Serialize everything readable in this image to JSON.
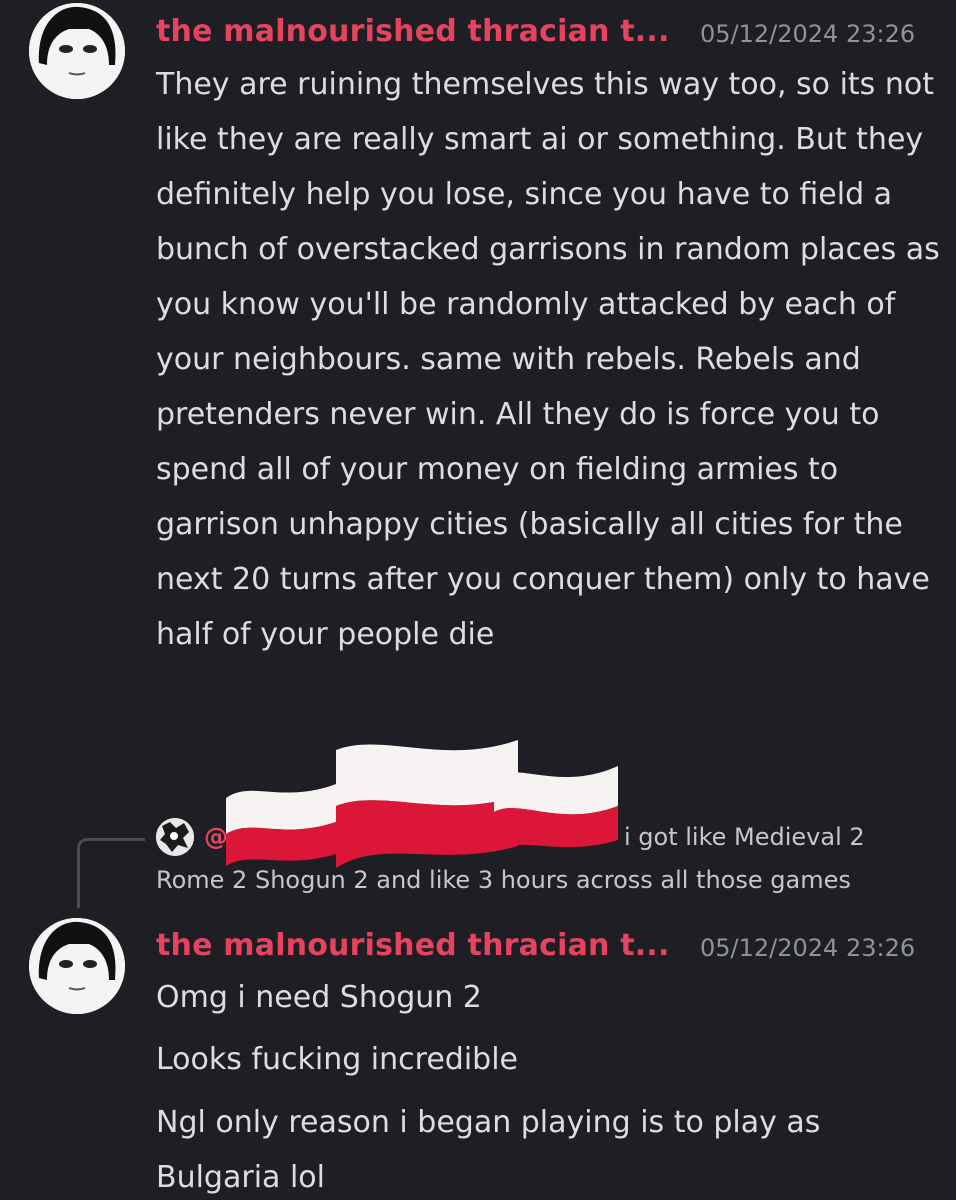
{
  "messages": [
    {
      "username": "the malnourished thracian t...",
      "timestamp": "05/12/2024 23:26",
      "text": "They are ruining themselves this way too, so its not like they are really smart ai or something. But they definitely help you lose, since you have to field a bunch of overstacked garrisons in random places as you know you'll be randomly attacked by each of your neighbours. same with rebels. Rebels and pretenders never win. All they do is force you to spend all of your money on fielding armies to garrison unhappy cities (basically all cities for the next 20 turns after you conquer them) only to have half of your people die"
    },
    {
      "username": "the malnourished thracian t...",
      "timestamp": "05/12/2024 23:26",
      "lines": [
        "Omg i need Shogun 2",
        "Looks fucking incredible",
        "Ngl only reason i began playing is to play as",
        "Bulgaria lol"
      ]
    }
  ],
  "reply": {
    "mention": "@",
    "text_part1": "i got like Medieval 2",
    "text_part2": "Rome 2 Shogun 2 and like 3 hours across all those games"
  },
  "colors": {
    "background": "#1e1f25",
    "username": "#e8435e",
    "timestamp": "#8f929c",
    "text": "#dcdde2"
  },
  "stickers": {
    "flag_icon": "poland-flag-icon",
    "count": 3
  }
}
